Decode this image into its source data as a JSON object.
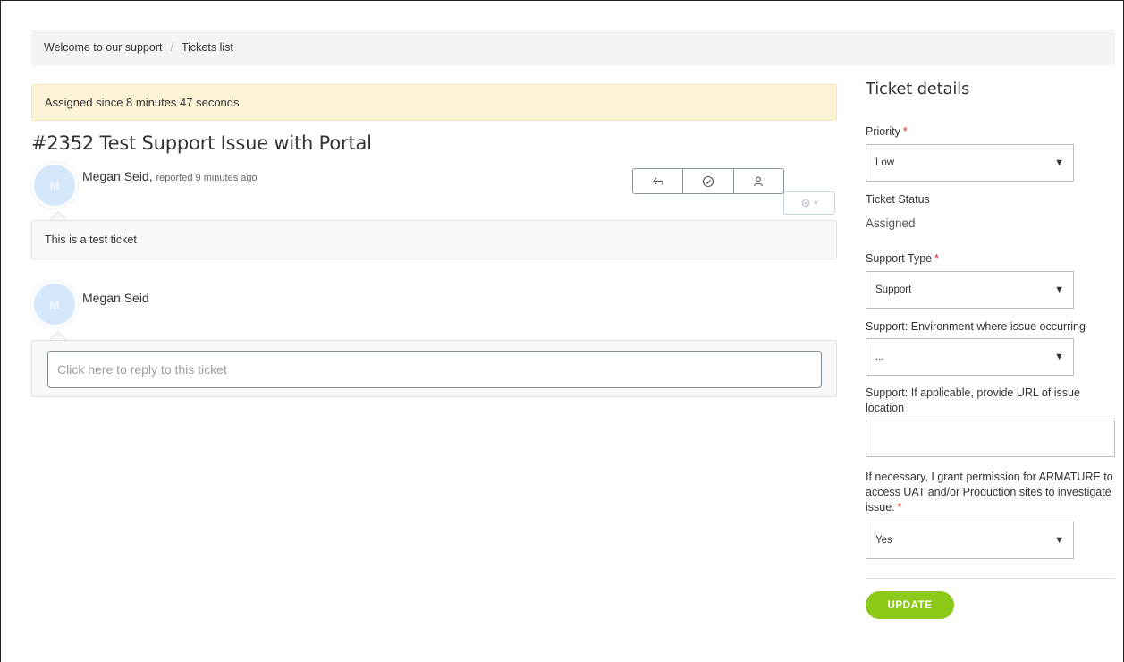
{
  "breadcrumb": {
    "home": "Welcome to our support",
    "separator": "/",
    "current": "Tickets list"
  },
  "banner": {
    "assigned_text": "Assigned since 8 minutes 47 seconds"
  },
  "ticket": {
    "title": "#2352 Test Support Issue with Portal",
    "author": "Megan Seid",
    "author_suffix": ",",
    "reported": "reported 9 minutes ago",
    "avatar_initial": "M",
    "message": "This is a test ticket",
    "actions": {
      "reply_icon": "reply-icon",
      "resolve_icon": "check-circle-icon",
      "assign_icon": "user-icon"
    },
    "settings_icon": "gear-icon",
    "settings_caret": "▾"
  },
  "reply": {
    "author": "Megan Seid",
    "avatar_initial": "M",
    "placeholder": "Click here to reply to this ticket"
  },
  "sidebar": {
    "title": "Ticket details",
    "required_marker": "*",
    "priority": {
      "label": "Priority",
      "value": "Low"
    },
    "status": {
      "label": "Ticket Status",
      "value": "Assigned"
    },
    "support_type": {
      "label": "Support Type",
      "value": "Support"
    },
    "environment": {
      "label": "Support: Environment where issue occurring",
      "value": "..."
    },
    "url": {
      "label": "Support: If applicable, provide URL of issue location",
      "value": ""
    },
    "permission": {
      "label": "If necessary, I grant permission for ARMATURE to access UAT and/or Production sites to investigate issue.",
      "value": "Yes"
    },
    "caret": "▼",
    "update_label": "UPDATE"
  },
  "colors": {
    "accent_green": "#8cc919",
    "banner_bg": "#fcf3d6",
    "required_red": "#d93025",
    "avatar_bg": "#d5e7fb"
  }
}
